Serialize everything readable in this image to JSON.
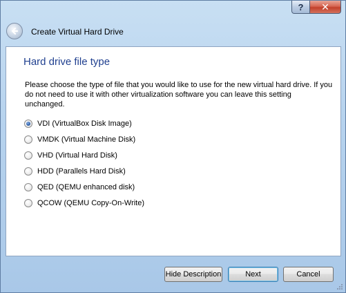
{
  "window": {
    "title": "Create Virtual Hard Drive",
    "help_label": "?",
    "close_label": "✕"
  },
  "page": {
    "heading": "Hard drive file type",
    "description": "Please choose the type of file that you would like to use for the new virtual hard drive. If you do not need to use it with other virtualization software you can leave this setting unchanged."
  },
  "options": [
    {
      "label": "VDI (VirtualBox Disk Image)",
      "selected": true
    },
    {
      "label": "VMDK (Virtual Machine Disk)",
      "selected": false
    },
    {
      "label": "VHD (Virtual Hard Disk)",
      "selected": false
    },
    {
      "label": "HDD (Parallels Hard Disk)",
      "selected": false
    },
    {
      "label": "QED (QEMU enhanced disk)",
      "selected": false
    },
    {
      "label": "QCOW (QEMU Copy-On-Write)",
      "selected": false
    }
  ],
  "buttons": {
    "hide_description": "Hide Description",
    "next": "Next",
    "cancel": "Cancel"
  }
}
